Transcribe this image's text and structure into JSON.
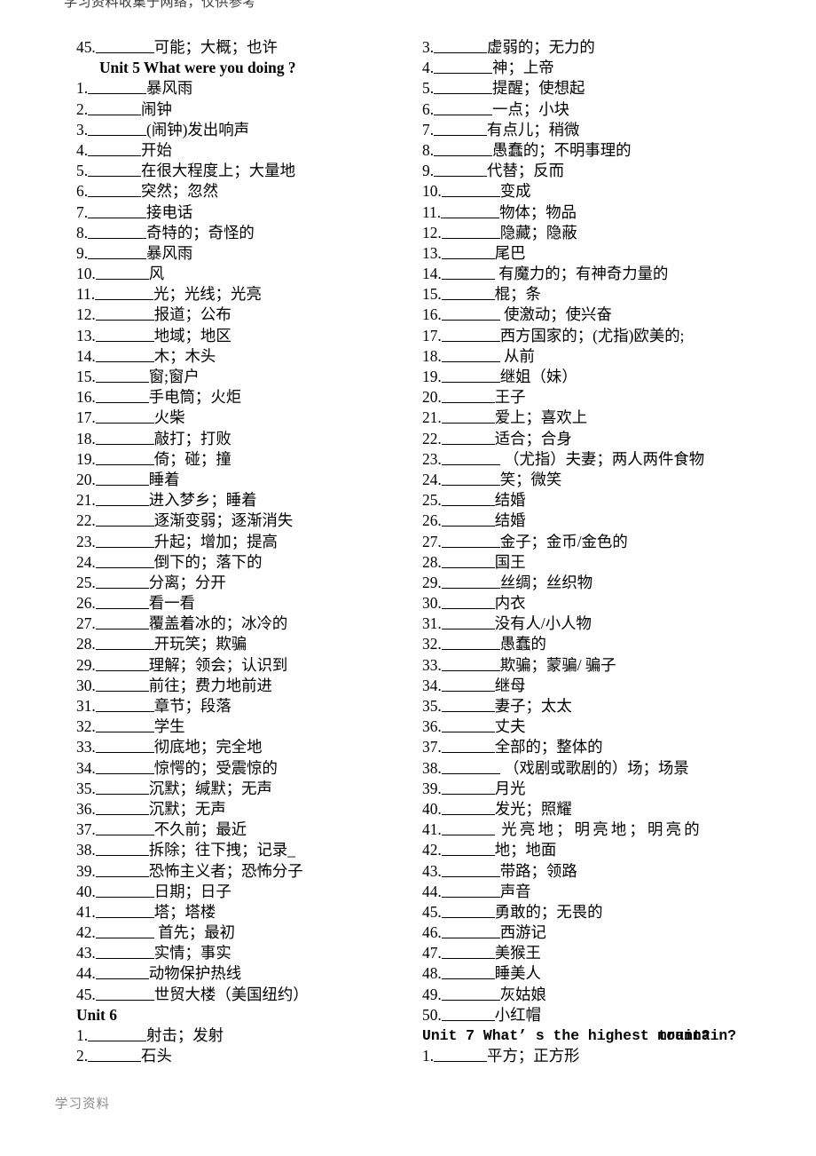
{
  "document": {
    "top_watermark": "学习资料收集于网络，仅供参考",
    "footer_watermark": "学习资料"
  },
  "left_column": [
    {
      "type": "item",
      "num": "45.",
      "blank": "long",
      "meaning": "可能；大概；也许"
    },
    {
      "type": "heading",
      "indent": true,
      "text": "Unit 5 What were you doing ?"
    },
    {
      "type": "item",
      "num": "1.",
      "blank": "long",
      "meaning": "暴风雨"
    },
    {
      "type": "item",
      "num": "2.",
      "blank": "med",
      "meaning": "闹钟"
    },
    {
      "type": "item",
      "num": "3.",
      "blank": "long",
      "meaning": "(闹钟)发出响声"
    },
    {
      "type": "item",
      "num": "4.",
      "blank": "med",
      "meaning": "开始"
    },
    {
      "type": "item",
      "num": "5.",
      "blank": "med",
      "meaning": "在很大程度上；大量地"
    },
    {
      "type": "item",
      "num": "6.",
      "blank": "med",
      "meaning": "突然；忽然"
    },
    {
      "type": "item",
      "num": "7.",
      "blank": "long",
      "meaning": "接电话"
    },
    {
      "type": "item",
      "num": "8.",
      "blank": "long",
      "meaning": "奇特的；奇怪的"
    },
    {
      "type": "item",
      "num": "9.",
      "blank": "long",
      "meaning": "暴风雨"
    },
    {
      "type": "item",
      "num": "10.",
      "blank": "med",
      "meaning": "风"
    },
    {
      "type": "item",
      "num": "11.",
      "blank": "long",
      "meaning": "光；光线；光亮"
    },
    {
      "type": "item",
      "num": "12.",
      "blank": "long",
      "meaning": "报道；公布"
    },
    {
      "type": "item",
      "num": "13.",
      "blank": "long",
      "meaning": "地域；地区"
    },
    {
      "type": "item",
      "num": "14.",
      "blank": "long",
      "meaning": "木；木头"
    },
    {
      "type": "item",
      "num": "15.",
      "blank": "med",
      "meaning": "窗;窗户"
    },
    {
      "type": "item",
      "num": "16.",
      "blank": "med",
      "meaning": "手电筒；火炬"
    },
    {
      "type": "item",
      "num": "17.",
      "blank": "long",
      "meaning": "火柴"
    },
    {
      "type": "item",
      "num": "18.",
      "blank": "long",
      "meaning": "敲打；打败"
    },
    {
      "type": "item",
      "num": "19.",
      "blank": "long",
      "meaning": "倚；碰；撞"
    },
    {
      "type": "item",
      "num": "20.",
      "blank": "med",
      "meaning": "睡着"
    },
    {
      "type": "item",
      "num": "21.",
      "blank": "med",
      "meaning": "进入梦乡；睡着"
    },
    {
      "type": "item",
      "num": "22.",
      "blank": "long",
      "meaning": "逐渐变弱；逐渐消失"
    },
    {
      "type": "item",
      "num": "23.",
      "blank": "long",
      "meaning": "升起；增加；提高"
    },
    {
      "type": "item",
      "num": "24.",
      "blank": "long",
      "meaning": "倒下的；落下的"
    },
    {
      "type": "item",
      "num": "25.",
      "blank": "med",
      "meaning": "分离；分开"
    },
    {
      "type": "item",
      "num": "26.",
      "blank": "med",
      "meaning": "看一看"
    },
    {
      "type": "item",
      "num": "27.",
      "blank": "med",
      "meaning": "覆盖着冰的；冰冷的"
    },
    {
      "type": "item",
      "num": "28.",
      "blank": "long",
      "meaning": "开玩笑；欺骗"
    },
    {
      "type": "item",
      "num": "29.",
      "blank": "med",
      "meaning": "理解；领会；认识到"
    },
    {
      "type": "item",
      "num": "30.",
      "blank": "med",
      "meaning": "前往；费力地前进"
    },
    {
      "type": "item",
      "num": "31.",
      "blank": "long",
      "meaning": "章节；段落"
    },
    {
      "type": "item",
      "num": "32.",
      "blank": "long",
      "meaning": "学生"
    },
    {
      "type": "item",
      "num": "33.",
      "blank": "long",
      "meaning": "彻底地；完全地"
    },
    {
      "type": "item",
      "num": "34.",
      "blank": "long",
      "meaning": "惊愕的；受震惊的"
    },
    {
      "type": "item",
      "num": "35.",
      "blank": "med",
      "meaning": "沉默；缄默；无声"
    },
    {
      "type": "item",
      "num": "36.",
      "blank": "med",
      "meaning": "沉默；无声"
    },
    {
      "type": "item",
      "num": "37.",
      "blank": "long",
      "meaning": "不久前；最近"
    },
    {
      "type": "item",
      "num": "38.",
      "blank": "med",
      "meaning": "拆除；往下拽；记录_"
    },
    {
      "type": "item",
      "num": "39.",
      "blank": "med",
      "meaning": "恐怖主义者；恐怖分子"
    },
    {
      "type": "item",
      "num": "40.",
      "blank": "long",
      "meaning": "日期；日子"
    },
    {
      "type": "item",
      "num": "41.",
      "blank": "long",
      "meaning": "塔；塔楼"
    },
    {
      "type": "item",
      "num": "42.",
      "blank": "long",
      "meaning": " 首先；最初"
    },
    {
      "type": "item",
      "num": "43.",
      "blank": "long",
      "meaning": "实情；事实"
    },
    {
      "type": "item",
      "num": "44.",
      "blank": "med",
      "meaning": "动物保护热线"
    },
    {
      "type": "item",
      "num": "45.",
      "blank": "long",
      "meaning": "世贸大楼（美国纽约）"
    },
    {
      "type": "heading",
      "indent": false,
      "text": "Unit 6"
    },
    {
      "type": "item",
      "num": "1.",
      "blank": "long",
      "meaning": "射击；发射"
    },
    {
      "type": "item",
      "num": "2.",
      "blank": "med",
      "meaning": "石头"
    }
  ],
  "right_column": [
    {
      "type": "item",
      "num": "3.",
      "blank": "med",
      "meaning": "虚弱的；无力的"
    },
    {
      "type": "item",
      "num": "4.",
      "blank": "long",
      "meaning": "神；上帝"
    },
    {
      "type": "item",
      "num": "5.",
      "blank": "long",
      "meaning": "提醒；使想起"
    },
    {
      "type": "item",
      "num": "6.",
      "blank": "long",
      "meaning": "一点；小块"
    },
    {
      "type": "item",
      "num": "7.",
      "blank": "med",
      "meaning": "有点儿；稍微"
    },
    {
      "type": "item",
      "num": "8.",
      "blank": "long",
      "meaning": "愚蠢的；不明事理的"
    },
    {
      "type": "item",
      "num": "9.",
      "blank": "med",
      "meaning": "代替；反而"
    },
    {
      "type": "item",
      "num": "10.",
      "blank": "long",
      "meaning": "变成"
    },
    {
      "type": "item",
      "num": "11.",
      "blank": "long",
      "meaning": "物体；物品"
    },
    {
      "type": "item",
      "num": "12.",
      "blank": "long",
      "meaning": "隐藏；隐蔽"
    },
    {
      "type": "item",
      "num": "13.",
      "blank": "med",
      "meaning": "尾巴"
    },
    {
      "type": "item",
      "num": "14.",
      "blank": "med",
      "meaning": " 有魔力的；有神奇力量的"
    },
    {
      "type": "item",
      "num": "15.",
      "blank": "med",
      "meaning": "棍；条"
    },
    {
      "type": "item",
      "num": "16.",
      "blank": "long",
      "meaning": " 使激动；使兴奋"
    },
    {
      "type": "item",
      "num": "17.",
      "blank": "long",
      "meaning": "西方国家的；(尤指)欧美的;"
    },
    {
      "type": "item",
      "num": "18.",
      "blank": "long",
      "meaning": " 从前"
    },
    {
      "type": "item",
      "num": "19.",
      "blank": "long",
      "meaning": "继姐（妹）"
    },
    {
      "type": "item",
      "num": "20.",
      "blank": "med",
      "meaning": "王子"
    },
    {
      "type": "item",
      "num": "21.",
      "blank": "med",
      "meaning": "爱上；喜欢上"
    },
    {
      "type": "item",
      "num": "22.",
      "blank": "med",
      "meaning": "适合；合身"
    },
    {
      "type": "item",
      "num": "23.",
      "blank": "long",
      "meaning": " （尤指）夫妻；两人两件食物"
    },
    {
      "type": "item",
      "num": "24.",
      "blank": "long",
      "meaning": "笑；微笑"
    },
    {
      "type": "item",
      "num": "25.",
      "blank": "med",
      "meaning": "结婚"
    },
    {
      "type": "item",
      "num": "26.",
      "blank": "med",
      "meaning": "结婚"
    },
    {
      "type": "item",
      "num": "27.",
      "blank": "long",
      "meaning": "金子；金币/金色的"
    },
    {
      "type": "item",
      "num": "28.",
      "blank": "med",
      "meaning": "国王"
    },
    {
      "type": "item",
      "num": "29.",
      "blank": "long",
      "meaning": "丝绸；丝织物"
    },
    {
      "type": "item",
      "num": "30.",
      "blank": "med",
      "meaning": "内衣"
    },
    {
      "type": "item",
      "num": "31.",
      "blank": "med",
      "meaning": "没有人/小人物"
    },
    {
      "type": "item",
      "num": "32.",
      "blank": "long",
      "meaning": "愚蠢的"
    },
    {
      "type": "item",
      "num": "33.",
      "blank": "long",
      "meaning": "欺骗；蒙骗/ 骗子"
    },
    {
      "type": "item",
      "num": "34.",
      "blank": "med",
      "meaning": "继母"
    },
    {
      "type": "item",
      "num": "35.",
      "blank": "med",
      "meaning": "妻子；太太"
    },
    {
      "type": "item",
      "num": "36.",
      "blank": "med",
      "meaning": "丈夫"
    },
    {
      "type": "item",
      "num": "37.",
      "blank": "med",
      "meaning": "全部的；整体的"
    },
    {
      "type": "item",
      "num": "38.",
      "blank": "long",
      "meaning": " （戏剧或歌剧的）场；场景"
    },
    {
      "type": "item",
      "num": "39.",
      "blank": "med",
      "meaning": "月光"
    },
    {
      "type": "item",
      "num": "40.",
      "blank": "med",
      "meaning": "发光；照耀"
    },
    {
      "type": "item",
      "num": "41.",
      "blank": "med",
      "meaning": " 光亮地；明亮地；明亮的",
      "spread": true
    },
    {
      "type": "item",
      "num": "42.",
      "blank": "med",
      "meaning": "地；地面"
    },
    {
      "type": "item",
      "num": "43.",
      "blank": "long",
      "meaning": "带路；领路"
    },
    {
      "type": "item",
      "num": "44.",
      "blank": "long",
      "meaning": "声音"
    },
    {
      "type": "item",
      "num": "45.",
      "blank": "med",
      "meaning": "勇敢的；无畏的"
    },
    {
      "type": "item",
      "num": "46.",
      "blank": "long",
      "meaning": "西游记"
    },
    {
      "type": "item",
      "num": "47.",
      "blank": "med",
      "meaning": "美猴王"
    },
    {
      "type": "item",
      "num": "48.",
      "blank": "med",
      "meaning": "睡美人"
    },
    {
      "type": "item",
      "num": "49.",
      "blank": "long",
      "meaning": "灰姑娘"
    },
    {
      "type": "item",
      "num": "50.",
      "blank": "med",
      "meaning": "小红帽"
    },
    {
      "type": "heading-mono",
      "text_before": "Unit 7 What’ s the highest ",
      "overlap_under": "mountain?",
      "overlap_over": "train?"
    },
    {
      "type": "item",
      "num": "1.",
      "blank": "med",
      "meaning": "平方；正方形"
    }
  ]
}
